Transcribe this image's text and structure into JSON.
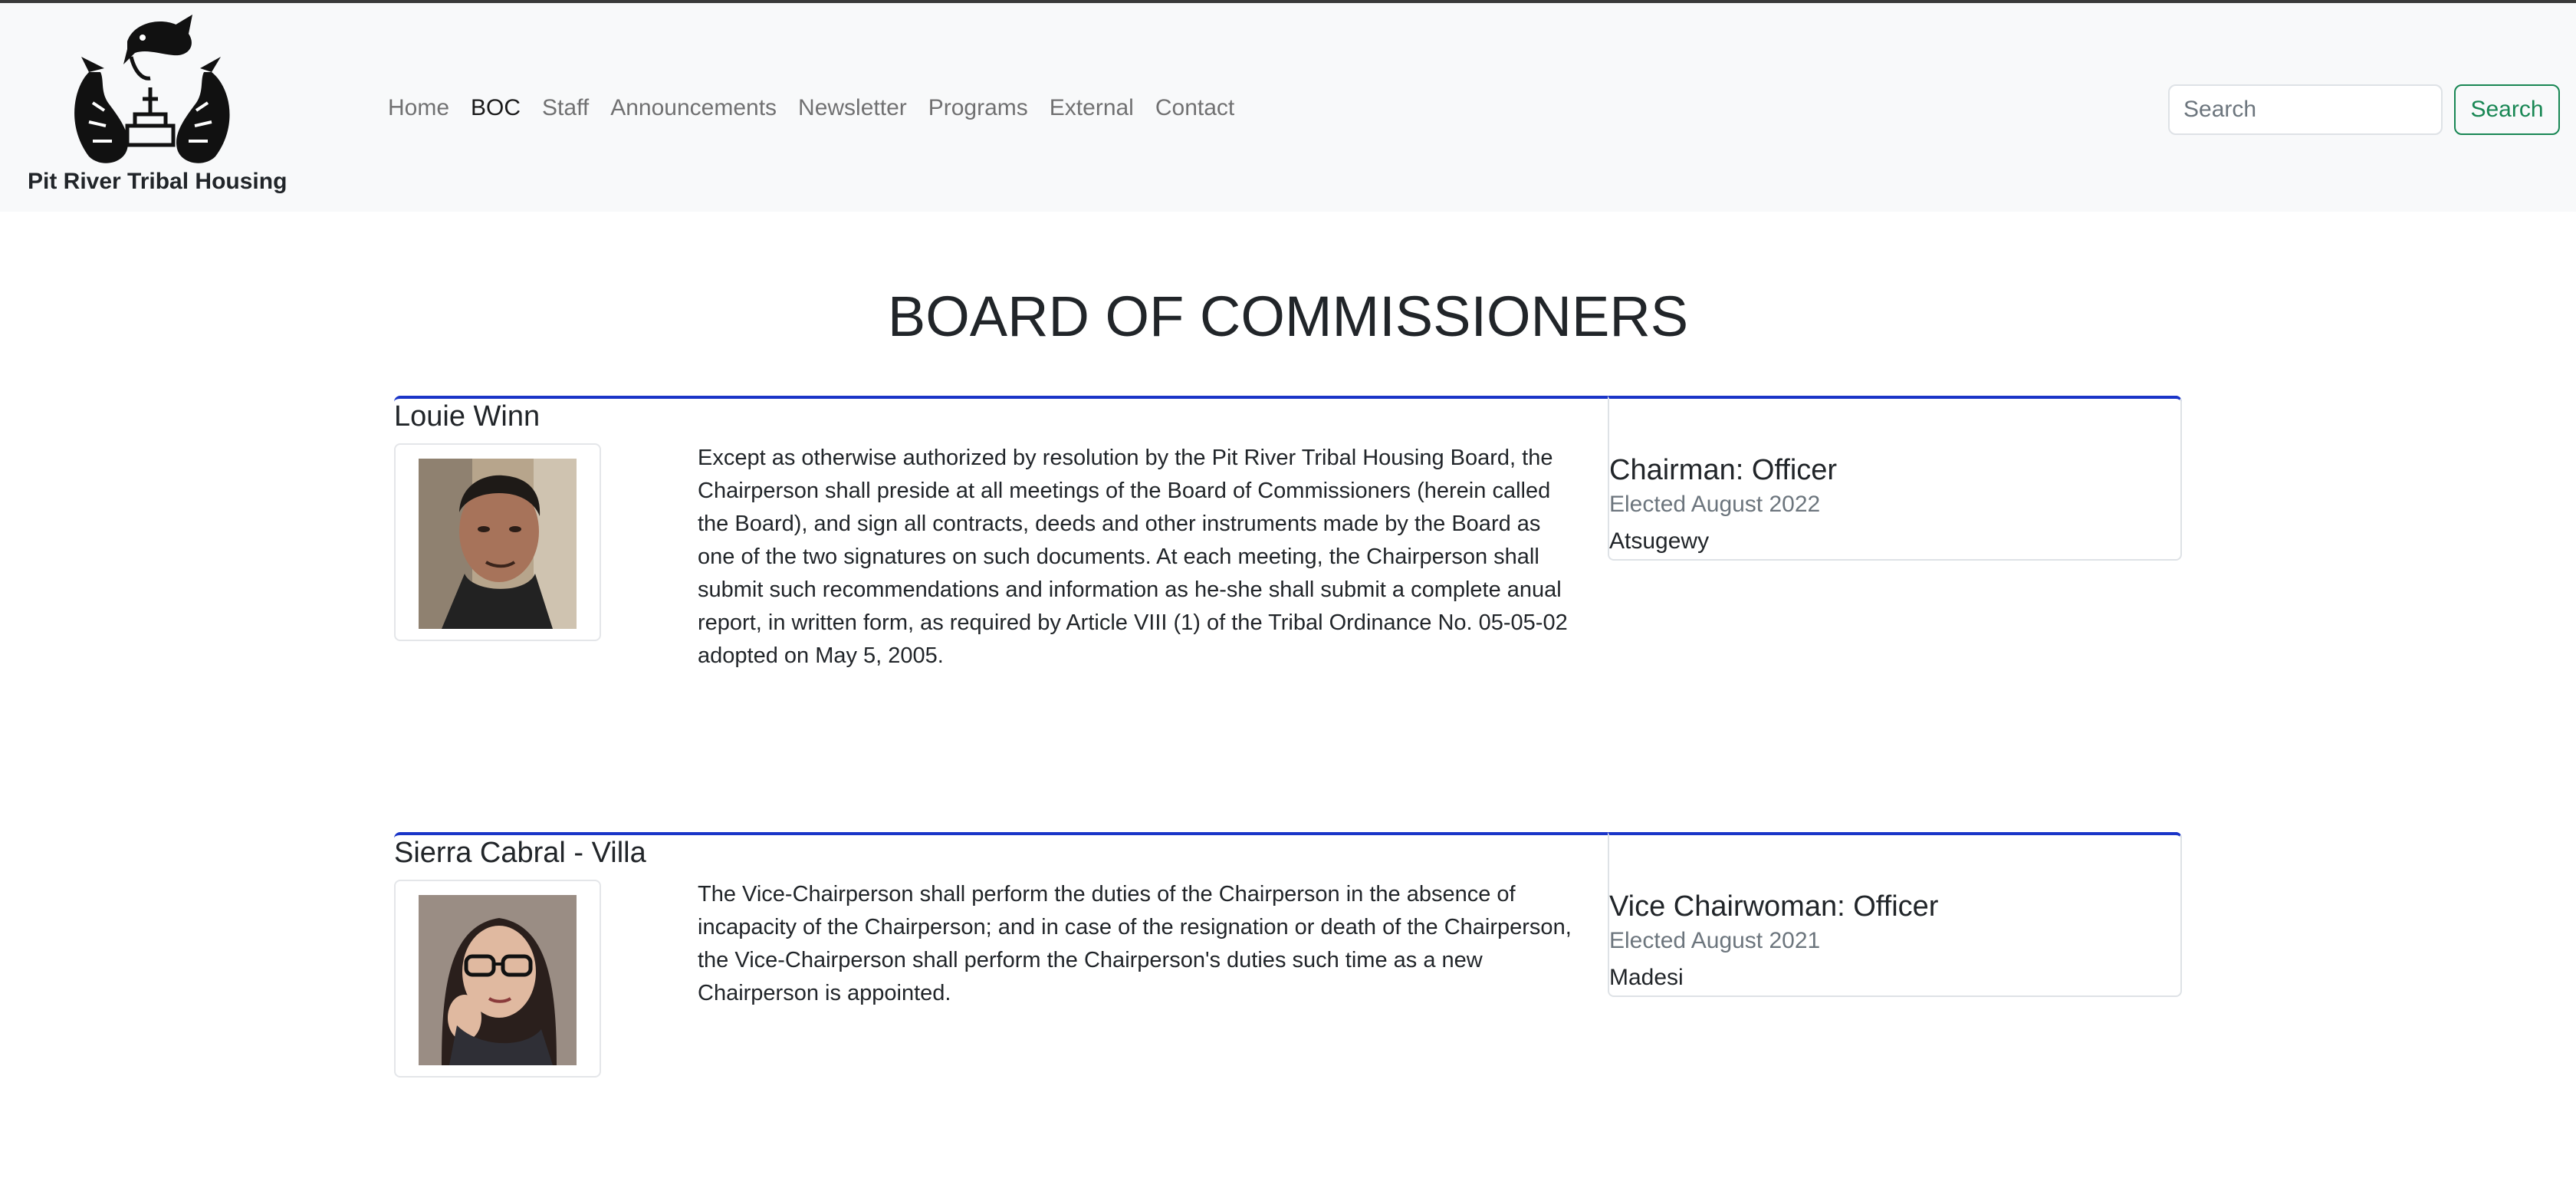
{
  "header": {
    "brand_name": "Pit River Tribal Housing",
    "nav": [
      {
        "label": "Home",
        "active": false
      },
      {
        "label": "BOC",
        "active": true
      },
      {
        "label": "Staff",
        "active": false
      },
      {
        "label": "Announcements",
        "active": false
      },
      {
        "label": "Newsletter",
        "active": false
      },
      {
        "label": "Programs",
        "active": false
      },
      {
        "label": "External",
        "active": false
      },
      {
        "label": "Contact",
        "active": false
      }
    ],
    "search": {
      "placeholder": "Search",
      "value": "",
      "button_label": "Search"
    }
  },
  "main": {
    "title": "BOARD OF COMMISSIONERS",
    "members": [
      {
        "name": "Louie Winn",
        "description": "Except as otherwise authorized by resolution by the Pit River Tribal Housing Board, the Chairperson shall preside at all meetings of the Board of Commissioners (herein called the Board), and sign all contracts, deeds and other instruments made by the Board as one of the two signatures on such documents. At each meeting, the Chairperson shall submit such recommendations and information as he-she shall submit a complete anual report, in written form, as required by Article VIII (1) of the Tribal Ordinance No. 05-05-02 adopted on May 5, 2005.",
        "role": "Chairman: Officer",
        "elected": "Elected August 2022",
        "tribe": "Atsugewy"
      },
      {
        "name": "Sierra Cabral - Villa",
        "description": "The Vice-Chairperson shall perform the duties of the Chairperson in the absence of incapacity of the Chairperson; and in case of the resignation or death of the Chairperson, the Vice-Chairperson shall perform the Chairperson's duties such time as a new Chairperson is appointed.",
        "role": "Vice Chairwoman: Officer",
        "elected": "Elected August 2021",
        "tribe": "Madesi"
      }
    ]
  },
  "colors": {
    "accent_border": "#1a35c8",
    "search_button": "#198754",
    "navbar_bg": "#f8f9fa"
  }
}
